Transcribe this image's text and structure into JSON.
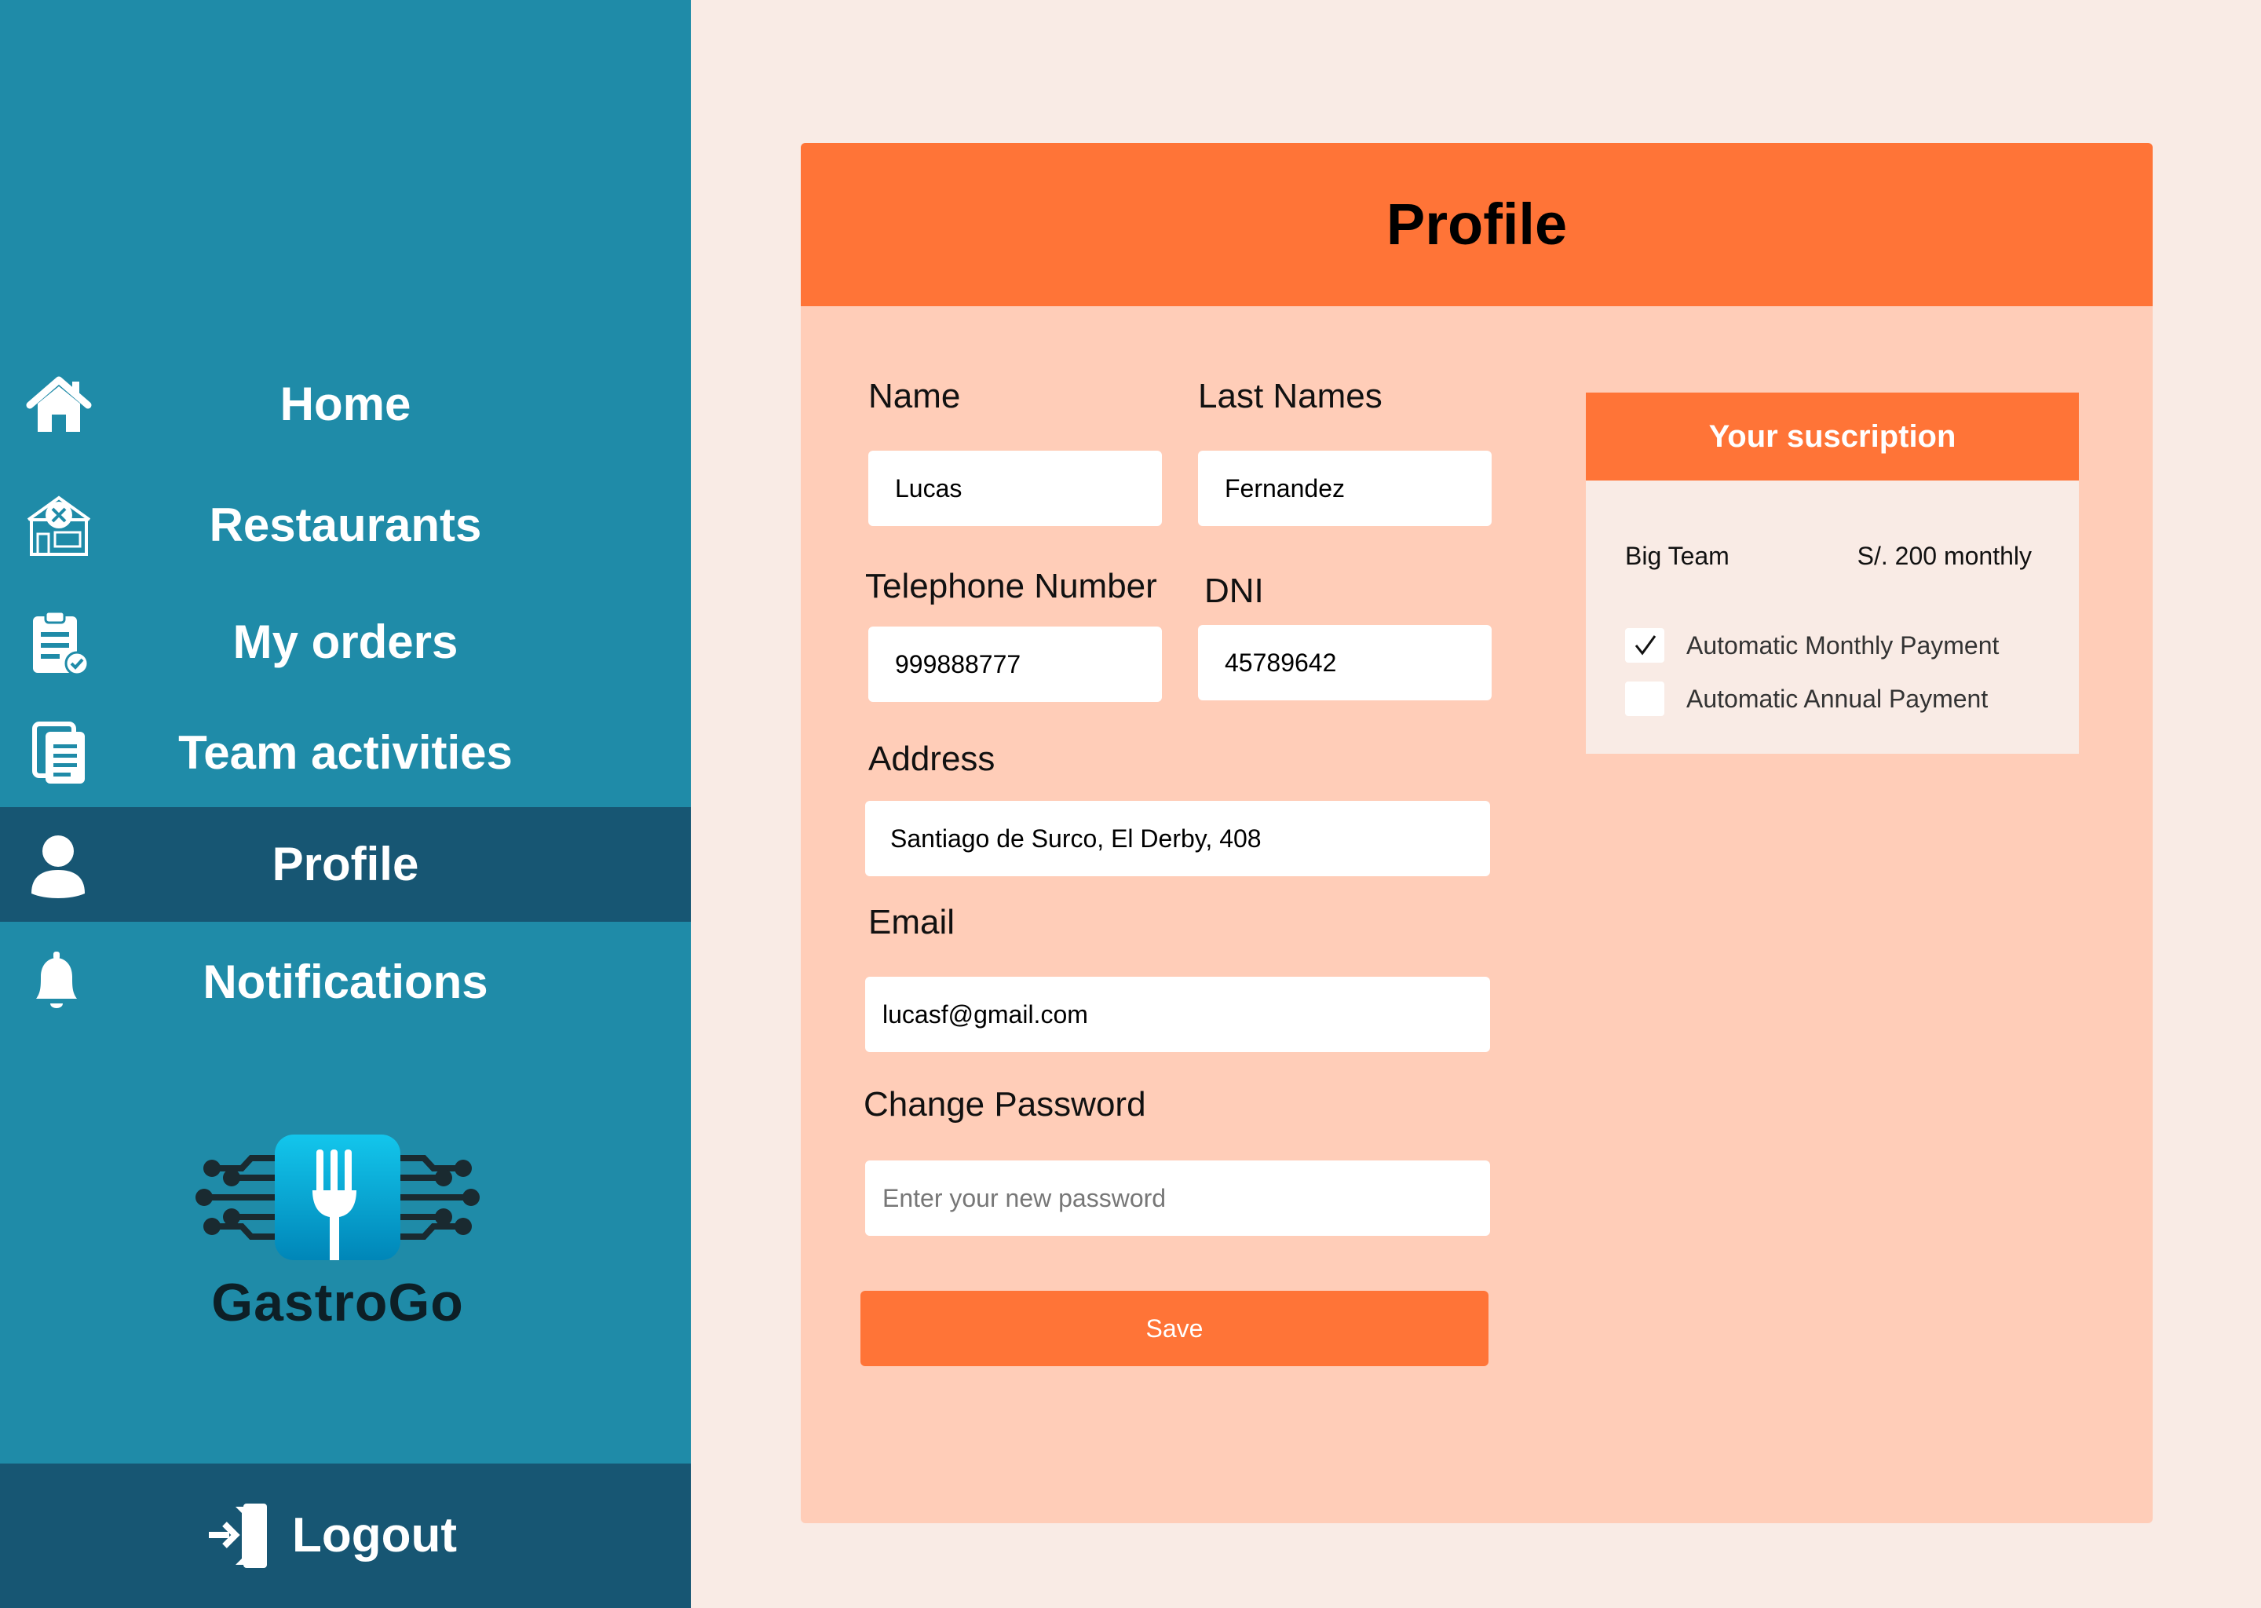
{
  "sidebar": {
    "items": [
      {
        "label": "Home",
        "icon": "home-icon"
      },
      {
        "label": "Restaurants",
        "icon": "restaurant-icon"
      },
      {
        "label": "My orders",
        "icon": "clipboard-check-icon"
      },
      {
        "label": "Team activities",
        "icon": "documents-icon"
      },
      {
        "label": "Profile",
        "icon": "user-icon",
        "active": true
      },
      {
        "label": "Notifications",
        "icon": "bell-icon"
      }
    ],
    "brand": "GastroGo",
    "logout_label": "Logout"
  },
  "profile": {
    "title": "Profile",
    "name_label": "Name",
    "name_value": "Lucas",
    "lastname_label": "Last Names",
    "lastname_value": "Fernandez",
    "phone_label": "Telephone Number",
    "phone_value": "999888777",
    "dni_label": "DNI",
    "dni_value": "45789642",
    "address_label": "Address",
    "address_value": "Santiago de Surco, El Derby, 408",
    "email_label": "Email",
    "email_value": "lucasf@gmail.com",
    "password_label": "Change Password",
    "password_placeholder": "Enter your new password",
    "save_label": "Save"
  },
  "subscription": {
    "title": "Your suscription",
    "plan": "Big Team",
    "price": "S/. 200 monthly",
    "options": [
      {
        "label": "Automatic Monthly Payment",
        "checked": true
      },
      {
        "label": "Automatic Annual Payment",
        "checked": false
      }
    ]
  },
  "colors": {
    "sidebar": "#1f8ba8",
    "sidebar_active": "#175673",
    "accent": "#ff7437",
    "card": "#ffcdb8",
    "page": "#f9ebe5"
  }
}
